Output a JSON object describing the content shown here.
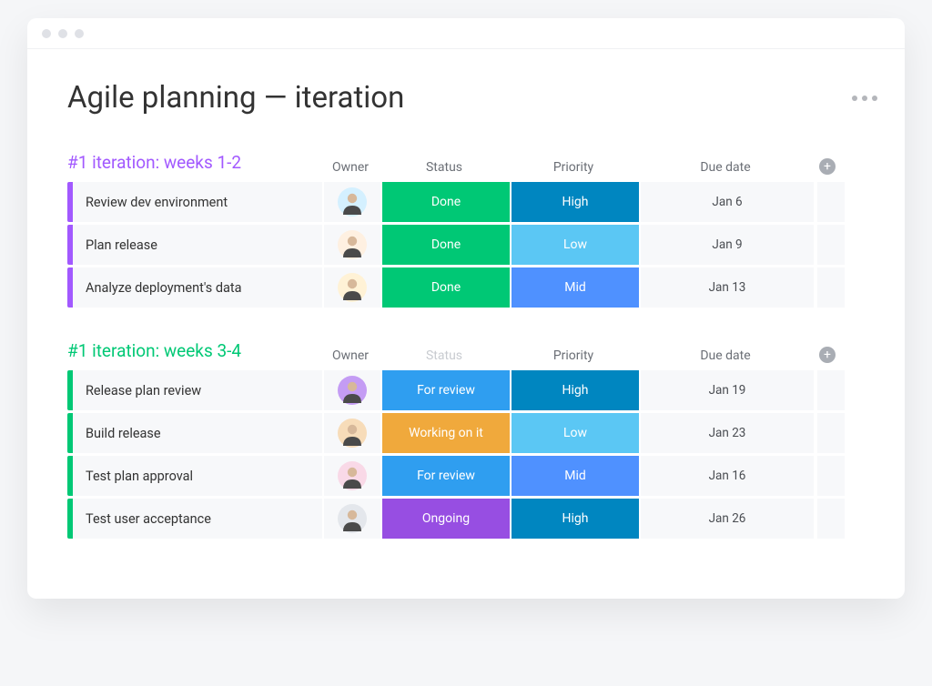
{
  "page": {
    "title": "Agile planning — iteration"
  },
  "columns": {
    "owner": "Owner",
    "status": "Status",
    "priority": "Priority",
    "due": "Due date"
  },
  "status_colors": {
    "Done": "#00c875",
    "For review": "#2f9ef0",
    "Working on it": "#f0a93c",
    "Ongoing": "#974ee2"
  },
  "priority_colors": {
    "High": "#0086c0",
    "Mid": "#4f91ff",
    "Low": "#5bc7f4"
  },
  "avatar_colors": [
    "#d4f0ff",
    "#fef0e1",
    "#fff2d6",
    "#c49cf4",
    "#f7dcb9",
    "#f9d9e7",
    "#e4e7ec"
  ],
  "groups": [
    {
      "title": "#1 iteration: weeks 1-2",
      "color": "#a259ff",
      "status_muted": false,
      "rows": [
        {
          "task": "Review dev environment",
          "avatar": 0,
          "status": "Done",
          "priority": "High",
          "due": "Jan 6"
        },
        {
          "task": "Plan release",
          "avatar": 1,
          "status": "Done",
          "priority": "Low",
          "due": "Jan 9"
        },
        {
          "task": "Analyze deployment's data",
          "avatar": 2,
          "status": "Done",
          "priority": "Mid",
          "due": "Jan 13"
        }
      ]
    },
    {
      "title": "#1 iteration: weeks 3-4",
      "color": "#00c875",
      "status_muted": true,
      "rows": [
        {
          "task": "Release plan review",
          "avatar": 3,
          "status": "For review",
          "priority": "High",
          "due": "Jan 19"
        },
        {
          "task": "Build release",
          "avatar": 4,
          "status": "Working on it",
          "priority": "Low",
          "due": "Jan 23"
        },
        {
          "task": "Test plan approval",
          "avatar": 5,
          "status": "For review",
          "priority": "Mid",
          "due": "Jan 16"
        },
        {
          "task": "Test user acceptance",
          "avatar": 6,
          "status": "Ongoing",
          "priority": "High",
          "due": "Jan 26"
        }
      ]
    }
  ]
}
